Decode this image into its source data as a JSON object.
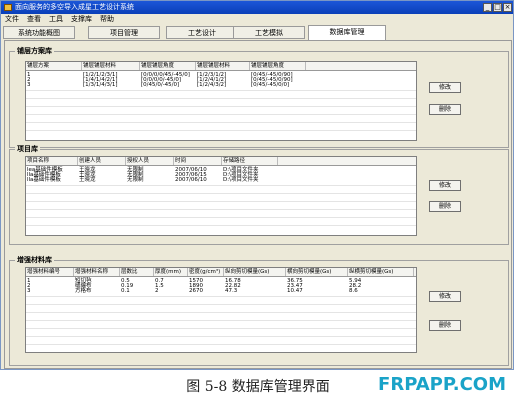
{
  "window": {
    "title": "面向服务的多空导入成星工艺设计系统",
    "minimize": "_",
    "maximize": "□",
    "close": "×"
  },
  "menu": [
    "文件",
    "查看",
    "工具",
    "支撑库",
    "帮助"
  ],
  "tabs": [
    {
      "label": "系统功能概图",
      "active": false
    },
    {
      "label": "项目管理",
      "active": false
    },
    {
      "label": "工艺设计",
      "active": false
    },
    {
      "label": "工艺模拟",
      "active": false
    },
    {
      "label": "数据库管理",
      "active": true
    }
  ],
  "sections": {
    "layup": {
      "title": "铺层方案库",
      "columns": [
        "铺层方案",
        "铺层铺层材料",
        "铺层铺层角度",
        "铺层铺层材料",
        "铺层铺层角度"
      ],
      "rows": [
        [
          "1",
          "[1/2/1/2/3/1]",
          "[0/0/0/0/45/-45/0]",
          "[1/2/3/1/2]",
          "[0/45/-45/0/90]"
        ],
        [
          "2",
          "[1/4/1/4/2/1]",
          "[0/0/0/0/-45/0]",
          "[1/2/4/1/2]",
          "[0/45/-45/0/90]"
        ],
        [
          "3",
          "[1/3/1/4/3/1]",
          "[0/45/0/-45/0]",
          "[1/2/4/3/2]",
          "[0/45/-45/0/0]"
        ]
      ],
      "buttons": {
        "edit": "修改",
        "delete": "删除"
      }
    },
    "project": {
      "title": "项目库",
      "columns": [
        "项目名称",
        "创建人员",
        "授权人员",
        "时间",
        "存储路径"
      ],
      "rows": [
        [
          "lea基础件模板",
          "王晓龙",
          "无限制",
          "2007/06/10",
          "D:\\项目文件夹"
        ],
        [
          "lla基础件模板",
          "王晓龙",
          "无限制",
          "2007/06/15",
          "D:\\项目文件夹"
        ],
        [
          "lla基础件模板",
          "王晓龙",
          "无限制",
          "2007/06/10",
          "D:\\项目文件夹"
        ]
      ],
      "buttons": {
        "edit": "修改",
        "delete": "删除"
      }
    },
    "material": {
      "title": "增强材料库",
      "columns": [
        "增强材料编号",
        "增强材料名称",
        "层数比",
        "厚度(mm)",
        "密度(g/cm³)",
        "纵向剪切模量(Gs)",
        "横向剪切模量(Gs)",
        "纵横剪切模量(Gs)"
      ],
      "rows": [
        [
          "1",
          "短切毡",
          "0.5",
          "0.7",
          "1570",
          "16.78",
          "36.75",
          "5.94"
        ],
        [
          "2",
          "缝编布",
          "0.19",
          "1.5",
          "1890",
          "22.82",
          "23.47",
          "28.2"
        ],
        [
          "3",
          "方格布",
          "0.1",
          "2",
          "2670",
          "47.3",
          "10.47",
          "8.6"
        ]
      ],
      "buttons": {
        "edit": "修改",
        "delete": "删除"
      }
    }
  },
  "caption": "图 5-8 数据库管理界面",
  "watermark": "FRPAPP.COM"
}
